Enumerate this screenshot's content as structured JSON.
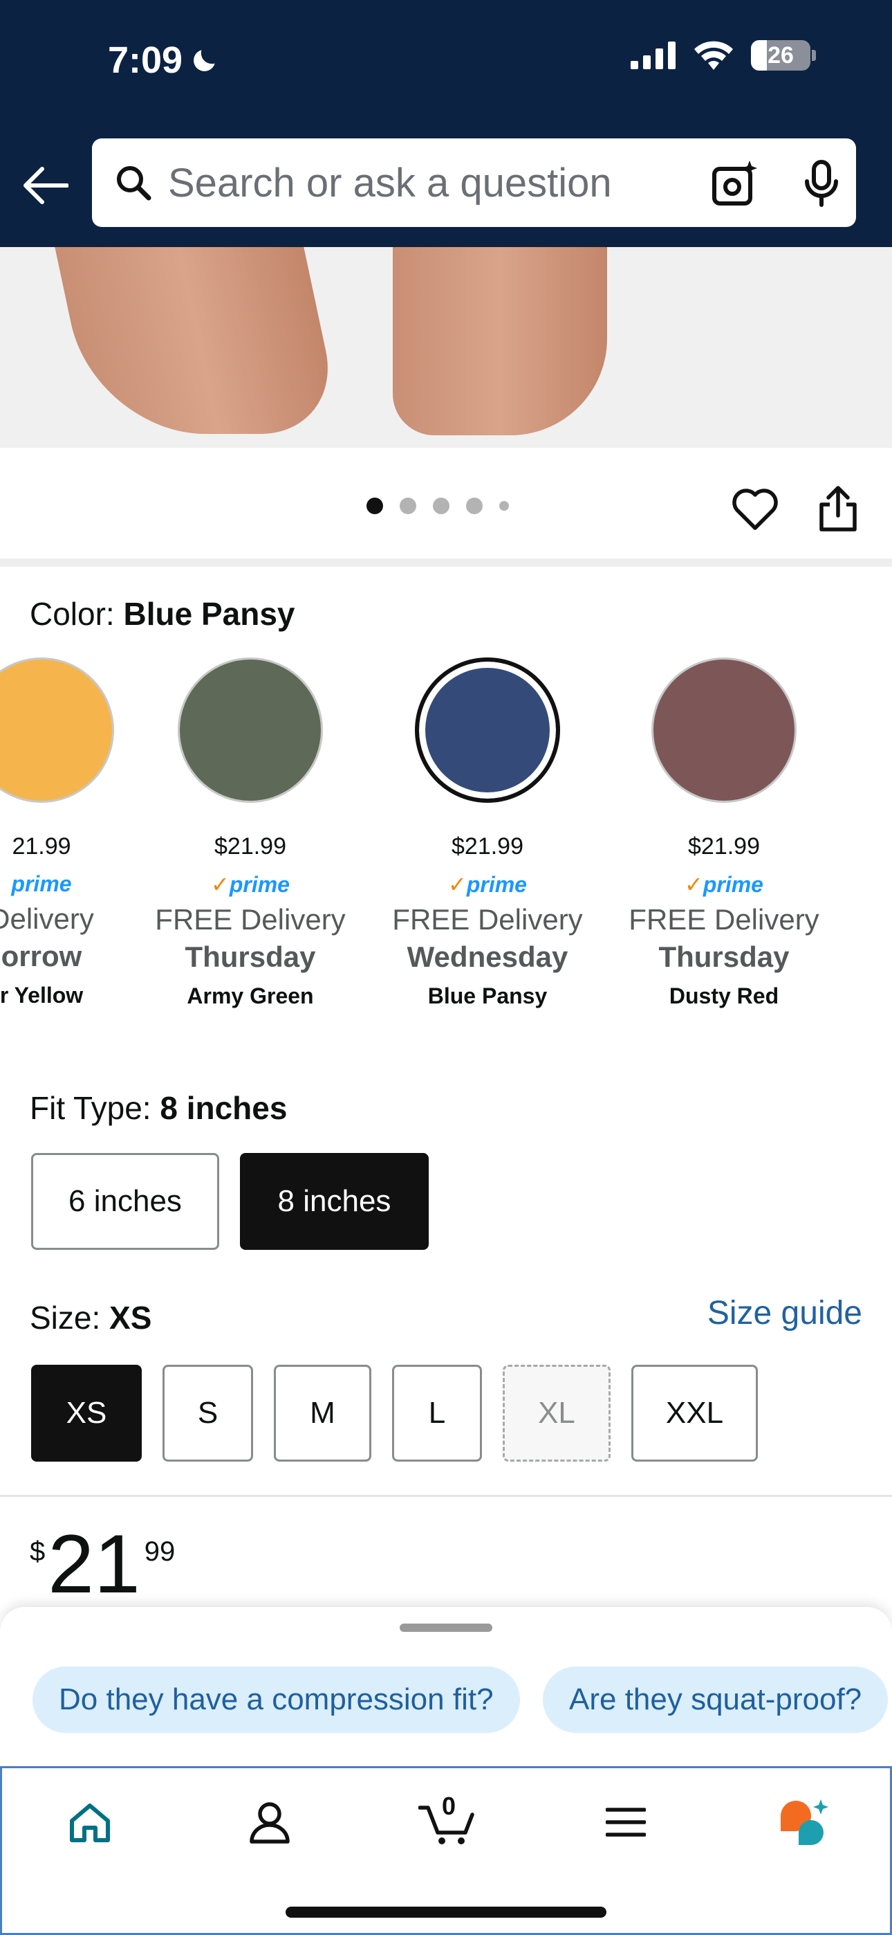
{
  "status_bar": {
    "time": "7:09",
    "battery": "26"
  },
  "search": {
    "placeholder": "Search or ask a question"
  },
  "carousel": {
    "dot_count": 5,
    "active_index": 0
  },
  "color": {
    "label": "Color:",
    "selected": "Blue Pansy",
    "swatches": [
      {
        "name": "Amber Yellow",
        "display_name": "r Yellow",
        "hex": "#f5b54c",
        "price": "21.99",
        "prime": "prime",
        "delivery": "Delivery",
        "day": "orrow"
      },
      {
        "name": "Army Green",
        "display_name": "Army Green",
        "hex": "#5e6a57",
        "price": "$21.99",
        "prime": "prime",
        "delivery": "FREE Delivery",
        "day": "Thursday"
      },
      {
        "name": "Blue Pansy",
        "display_name": "Blue Pansy",
        "hex": "#344b7a",
        "price": "$21.99",
        "prime": "prime",
        "delivery": "FREE Delivery",
        "day": "Wednesday"
      },
      {
        "name": "Dusty Red",
        "display_name": "Dusty Red",
        "hex": "#7d5758",
        "price": "$21.99",
        "prime": "prime",
        "delivery": "FREE Delivery",
        "day": "Thursday"
      }
    ]
  },
  "fit_type": {
    "label": "Fit Type:",
    "selected": "8 inches",
    "options": [
      "6 inches",
      "8 inches"
    ]
  },
  "size": {
    "label": "Size:",
    "selected": "XS",
    "guide_link": "Size guide",
    "options": [
      "XS",
      "S",
      "M",
      "L",
      "XL",
      "XXL"
    ],
    "unavailable": [
      "XL"
    ]
  },
  "price": {
    "currency": "$",
    "whole": "21",
    "fraction": "99"
  },
  "suggestions": [
    "Do they have a compression fit?",
    "Are they squat-proof?"
  ],
  "tabbar": {
    "cart_count": "0"
  },
  "colors": {
    "header_bg": "#0b2243",
    "link": "#2162a1",
    "prime_blue": "#1a98ff",
    "accent_teal": "#007185",
    "rufus_orange": "#f36b21"
  }
}
